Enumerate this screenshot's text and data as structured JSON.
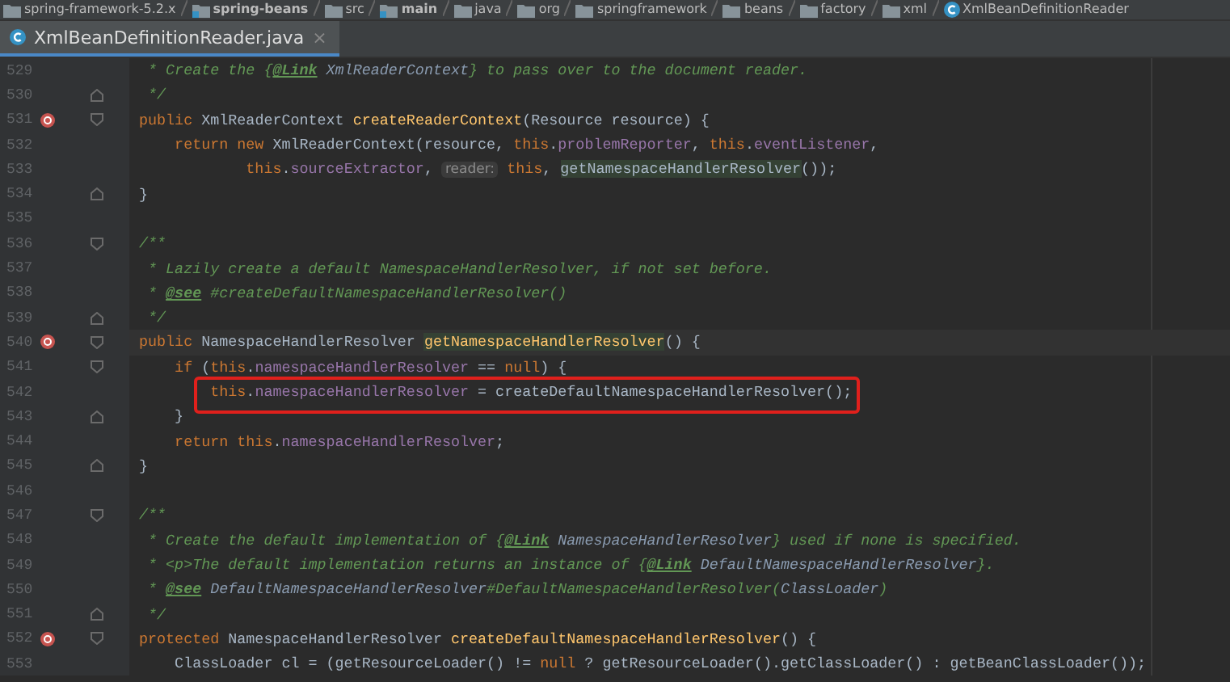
{
  "breadcrumbs": [
    {
      "label": "spring-framework-5.2.x",
      "kind": "folder"
    },
    {
      "label": "spring-beans",
      "kind": "module"
    },
    {
      "label": "src",
      "kind": "folder"
    },
    {
      "label": "main",
      "kind": "module"
    },
    {
      "label": "java",
      "kind": "folder"
    },
    {
      "label": "org",
      "kind": "folder"
    },
    {
      "label": "springframework",
      "kind": "folder"
    },
    {
      "label": "beans",
      "kind": "folder"
    },
    {
      "label": "factory",
      "kind": "folder"
    },
    {
      "label": "xml",
      "kind": "folder"
    },
    {
      "label": "XmlBeanDefinitionReader",
      "kind": "class"
    }
  ],
  "tabs": [
    {
      "label": "XmlBeanDefinitionReader.java",
      "selected": true,
      "close": "×"
    }
  ],
  "lines": [
    {
      "number": "529",
      "tokens": [
        {
          "kind": "doc",
          "t": " * Create the {"
        },
        {
          "kind": "doctag",
          "t": "@Link"
        },
        {
          "kind": "docref",
          "t": " XmlReaderContext"
        },
        {
          "kind": "doc",
          "t": "} to pass over to the document reader."
        }
      ]
    },
    {
      "number": "530",
      "fold_end": true,
      "tokens": [
        {
          "kind": "doc",
          "t": " */"
        }
      ]
    },
    {
      "number": "531",
      "override": true,
      "fold_start": true,
      "tokens": [
        {
          "kind": "kw",
          "t": "public "
        },
        {
          "kind": "plain",
          "t": "XmlReaderContext "
        },
        {
          "kind": "decl",
          "t": "createReaderContext"
        },
        {
          "kind": "plain",
          "t": "(Resource resource) {"
        }
      ]
    },
    {
      "number": "532",
      "tokens": [
        {
          "kind": "kw",
          "t": "    return new "
        },
        {
          "kind": "plain",
          "t": "XmlReaderContext(resource, "
        },
        {
          "kind": "kw",
          "t": "this"
        },
        {
          "kind": "plain",
          "t": "."
        },
        {
          "kind": "field",
          "t": "problemReporter"
        },
        {
          "kind": "plain",
          "t": ", "
        },
        {
          "kind": "kw",
          "t": "this"
        },
        {
          "kind": "plain",
          "t": "."
        },
        {
          "kind": "field",
          "t": "eventListener"
        },
        {
          "kind": "plain",
          "t": ","
        }
      ]
    },
    {
      "number": "533",
      "tokens": [
        {
          "kind": "kw",
          "t": "            this"
        },
        {
          "kind": "plain",
          "t": "."
        },
        {
          "kind": "field",
          "t": "sourceExtractor"
        },
        {
          "kind": "plain",
          "t": ", "
        },
        {
          "kind": "hint",
          "t": "reader:"
        },
        {
          "kind": "kw",
          "t": " this"
        },
        {
          "kind": "plain",
          "t": ", "
        },
        {
          "kind": "match",
          "t": "getNamespaceHandlerResolver"
        },
        {
          "kind": "plain",
          "t": "());"
        }
      ]
    },
    {
      "number": "534",
      "fold_end": true,
      "tokens": [
        {
          "kind": "plain",
          "t": "}"
        }
      ]
    },
    {
      "number": "535"
    },
    {
      "number": "536",
      "fold_start": true,
      "tokens": [
        {
          "kind": "doc",
          "t": "/**"
        }
      ]
    },
    {
      "number": "537",
      "tokens": [
        {
          "kind": "doc",
          "t": " * Lazily create a default NamespaceHandlerResolver, if not set before."
        }
      ]
    },
    {
      "number": "538",
      "tokens": [
        {
          "kind": "doc",
          "t": " * "
        },
        {
          "kind": "doctag",
          "t": "@see"
        },
        {
          "kind": "doc",
          "t": " #createDefaultNamespaceHandlerResolver()"
        }
      ]
    },
    {
      "number": "539",
      "fold_end": true,
      "tokens": [
        {
          "kind": "doc",
          "t": " */"
        }
      ]
    },
    {
      "number": "540",
      "override": true,
      "fold_start": true,
      "current": true,
      "tokens": [
        {
          "kind": "kw",
          "t": "public "
        },
        {
          "kind": "plain",
          "t": "NamespaceHandlerResolver "
        },
        {
          "kind": "decl-match",
          "t": "getNamespaceHandlerResolver"
        },
        {
          "kind": "plain",
          "t": "() {"
        }
      ]
    },
    {
      "number": "541",
      "fold_start": true,
      "tokens": [
        {
          "kind": "kw",
          "t": "    if "
        },
        {
          "kind": "plain",
          "t": "("
        },
        {
          "kind": "kw",
          "t": "this"
        },
        {
          "kind": "plain",
          "t": "."
        },
        {
          "kind": "field",
          "t": "namespaceHandlerResolver"
        },
        {
          "kind": "plain",
          "t": " == "
        },
        {
          "kind": "kw",
          "t": "null"
        },
        {
          "kind": "plain",
          "t": ") {"
        }
      ]
    },
    {
      "number": "542",
      "boxed": true,
      "tokens": [
        {
          "kind": "kw",
          "t": "        this"
        },
        {
          "kind": "plain",
          "t": "."
        },
        {
          "kind": "field",
          "t": "namespaceHandlerResolver"
        },
        {
          "kind": "plain",
          "t": " = createDefaultNamespaceHandlerResolver();"
        }
      ]
    },
    {
      "number": "543",
      "fold_end": true,
      "tokens": [
        {
          "kind": "plain",
          "t": "    }"
        }
      ]
    },
    {
      "number": "544",
      "tokens": [
        {
          "kind": "kw",
          "t": "    return this"
        },
        {
          "kind": "plain",
          "t": "."
        },
        {
          "kind": "field",
          "t": "namespaceHandlerResolver"
        },
        {
          "kind": "plain",
          "t": ";"
        }
      ]
    },
    {
      "number": "545",
      "fold_end": true,
      "tokens": [
        {
          "kind": "plain",
          "t": "}"
        }
      ]
    },
    {
      "number": "546"
    },
    {
      "number": "547",
      "fold_start": true,
      "tokens": [
        {
          "kind": "doc",
          "t": "/**"
        }
      ]
    },
    {
      "number": "548",
      "tokens": [
        {
          "kind": "doc",
          "t": " * Create the default implementation of {"
        },
        {
          "kind": "doctag",
          "t": "@Link"
        },
        {
          "kind": "docref",
          "t": " NamespaceHandlerResolver"
        },
        {
          "kind": "doc",
          "t": "} used if none is specified."
        }
      ]
    },
    {
      "number": "549",
      "tokens": [
        {
          "kind": "doc",
          "t": " * <p>The default implementation returns an instance of {"
        },
        {
          "kind": "doctag",
          "t": "@Link"
        },
        {
          "kind": "docref",
          "t": " DefaultNamespaceHandlerResolver"
        },
        {
          "kind": "doc",
          "t": "}."
        }
      ]
    },
    {
      "number": "550",
      "tokens": [
        {
          "kind": "doc",
          "t": " * "
        },
        {
          "kind": "doctag",
          "t": "@see"
        },
        {
          "kind": "docref",
          "t": " DefaultNamespaceHandlerResolver"
        },
        {
          "kind": "doc",
          "t": "#DefaultNamespaceHandlerResolver("
        },
        {
          "kind": "docref",
          "t": "ClassLoader"
        },
        {
          "kind": "doc",
          "t": ")"
        }
      ]
    },
    {
      "number": "551",
      "fold_end": true,
      "tokens": [
        {
          "kind": "doc",
          "t": " */"
        }
      ]
    },
    {
      "number": "552",
      "override": true,
      "fold_start": true,
      "tokens": [
        {
          "kind": "kw",
          "t": "protected "
        },
        {
          "kind": "plain",
          "t": "NamespaceHandlerResolver "
        },
        {
          "kind": "decl",
          "t": "createDefaultNamespaceHandlerResolver"
        },
        {
          "kind": "plain",
          "t": "() {"
        }
      ]
    },
    {
      "number": "553",
      "tokens": [
        {
          "kind": "plain",
          "t": "    ClassLoader cl = (getResourceLoader() != "
        },
        {
          "kind": "kw",
          "t": "null"
        },
        {
          "kind": "plain",
          "t": " ? getResourceLoader().getClassLoader() : getBeanClassLoader());"
        }
      ]
    }
  ]
}
